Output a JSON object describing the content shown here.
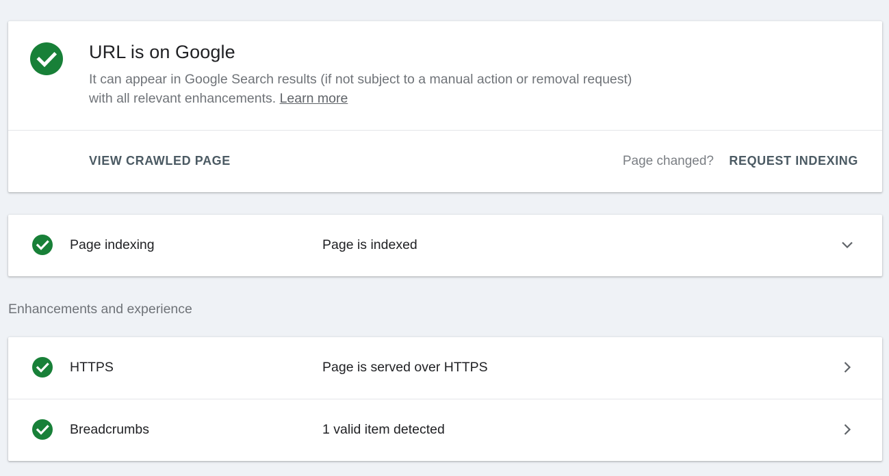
{
  "status": {
    "title": "URL is on Google",
    "description": "It can appear in Google Search results (if not subject to a manual action or removal request) with all relevant enhancements.",
    "learn_more": "Learn more",
    "view_crawled_page": "VIEW CRAWLED PAGE",
    "page_changed": "Page changed?",
    "request_indexing": "REQUEST INDEXING"
  },
  "indexing": {
    "label": "Page indexing",
    "value": "Page is indexed",
    "icon": "chevron-down-icon"
  },
  "enhancements": {
    "heading": "Enhancements and experience",
    "items": [
      {
        "label": "HTTPS",
        "value": "Page is served over HTTPS",
        "icon": "chevron-right-icon"
      },
      {
        "label": "Breadcrumbs",
        "value": "1 valid item detected",
        "icon": "chevron-right-icon"
      }
    ]
  },
  "colors": {
    "success": "#188038",
    "background": "#eff2f6",
    "action_text": "#4b5a63"
  }
}
